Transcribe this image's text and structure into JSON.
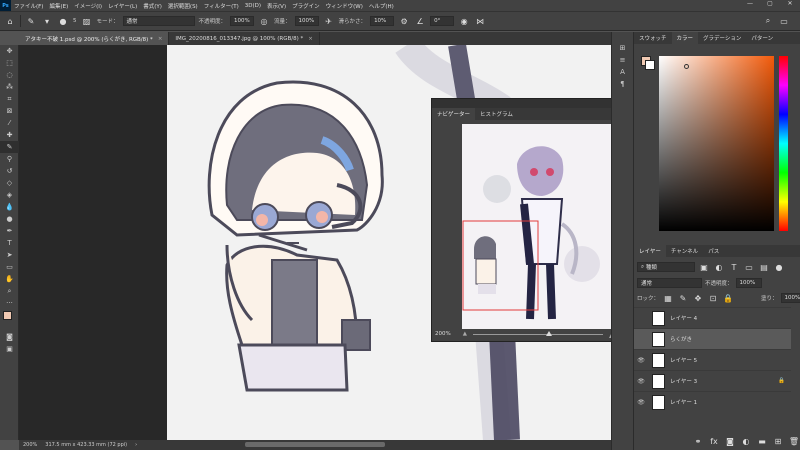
{
  "app": {
    "logo": "Ps"
  },
  "menu": [
    "ファイル(F)",
    "編集(E)",
    "イメージ(I)",
    "レイヤー(L)",
    "書式(Y)",
    "選択範囲(S)",
    "フィルター(T)",
    "3D(D)",
    "表示(V)",
    "プラグイン",
    "ウィンドウ(W)",
    "ヘルプ(H)"
  ],
  "window_controls": [
    "—",
    "▢",
    "✕"
  ],
  "options": {
    "mode_label": "モード：",
    "mode_value": "通常",
    "opacity_label": "不透明度：",
    "opacity_value": "100%",
    "flow_label": "流量：",
    "flow_value": "100%",
    "smoothing_label": "滑らかさ：",
    "smoothing_value": "10%",
    "angle_value": "0°",
    "brush_size": "5"
  },
  "tabs": [
    {
      "label": "アタキー不破 1.psd @ 200% (らくがき, RGB/8) *"
    },
    {
      "label": "IMG_20200816_013347.jpg @ 100% (RGB/8) *"
    }
  ],
  "status": {
    "zoom": "200%",
    "docinfo": "317.5 mm x 423.33 mm (72 ppi)"
  },
  "navigator": {
    "tabs": [
      "ナビゲーター",
      "ヒストグラム"
    ],
    "zoom": "200%"
  },
  "color_panel": {
    "tabs": [
      "スウォッチ",
      "カラー",
      "グラデーション",
      "パターン"
    ],
    "active_tab": "カラー",
    "fg_color": "#f0c9b2",
    "bg_color": "#ffffff"
  },
  "layers_panel": {
    "tabs": [
      "レイヤー",
      "チャンネル",
      "パス"
    ],
    "filter_label": "種類",
    "blend_mode": "通常",
    "opacity_label": "不透明度：",
    "opacity_value": "100%",
    "lock_label": "ロック：",
    "fill_label": "塗り：",
    "fill_value": "100%",
    "layers": [
      {
        "name": "レイヤー 4",
        "visible": false,
        "selected": false,
        "locked": false
      },
      {
        "name": "らくがき",
        "visible": false,
        "selected": true,
        "locked": false
      },
      {
        "name": "レイヤー 5",
        "visible": true,
        "selected": false,
        "locked": false
      },
      {
        "name": "レイヤー 3",
        "visible": true,
        "selected": false,
        "locked": true
      },
      {
        "name": "レイヤー 1",
        "visible": true,
        "selected": false,
        "locked": false
      }
    ],
    "footer_icons": [
      "link-icon",
      "fx-icon",
      "mask-icon",
      "adjustment-icon",
      "folder-icon",
      "new-layer-icon",
      "trash-icon"
    ]
  }
}
